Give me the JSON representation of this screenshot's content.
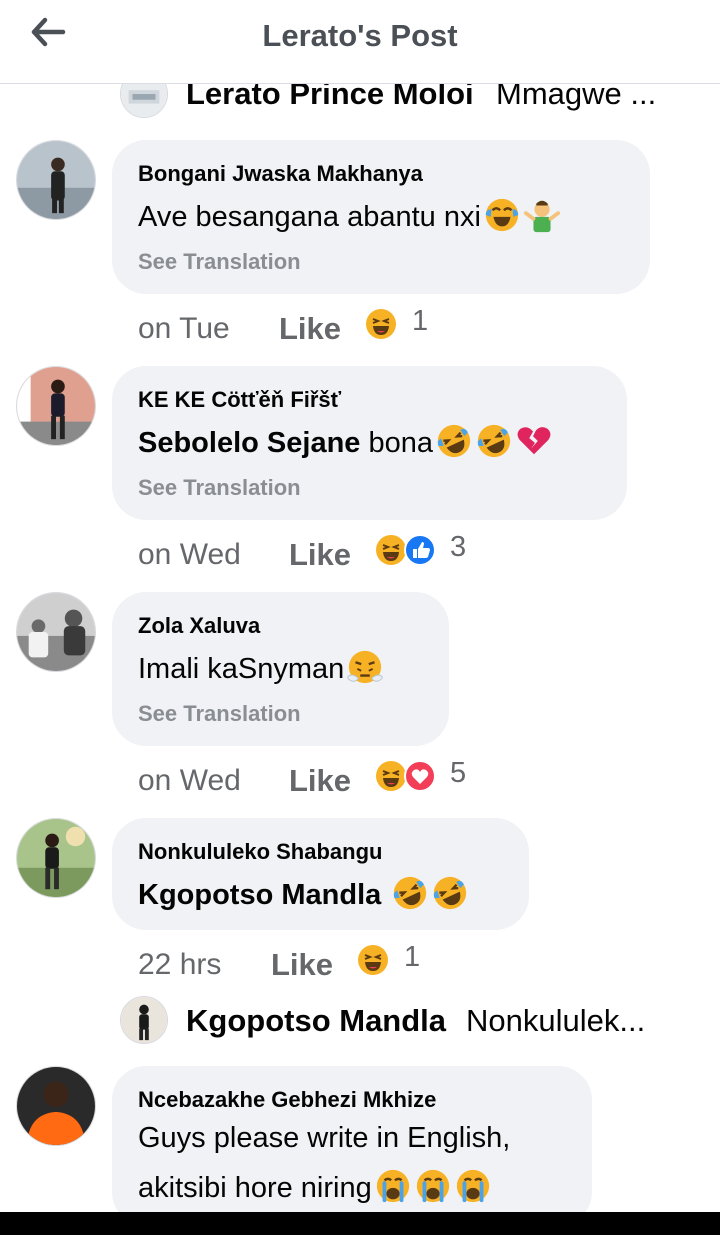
{
  "header": {
    "title": "Lerato's Post"
  },
  "reply_top": {
    "name": "Lerato Prince Moloi",
    "snippet": "Mmagwe ..."
  },
  "comments": [
    {
      "author": "Bongani Jwaska Makhanya",
      "text": "Ave besangana abantu nxi",
      "see_translation": "See Translation",
      "time": "on Tue",
      "like": "Like",
      "reaction_count": "1"
    },
    {
      "author": "KE KE Cötťěň Fiřšť",
      "mention": "Sebolelo Sejane",
      "text": "bona",
      "see_translation": "See Translation",
      "time": "on Wed",
      "like": "Like",
      "reaction_count": "3"
    },
    {
      "author": "Zola Xaluva",
      "text": "Imali kaSnyman",
      "see_translation": "See Translation",
      "time": "on Wed",
      "like": "Like",
      "reaction_count": "5"
    },
    {
      "author": "Nonkululeko Shabangu",
      "mention": "Kgopotso Mandla",
      "time": "22 hrs",
      "like": "Like",
      "reaction_count": "1"
    },
    {
      "author": "Ncebazakhe Gebhezi Mkhize",
      "line1": "Guys please write in English,",
      "line2": "akitsibi hore niring"
    }
  ],
  "reply_bottom": {
    "name": "Kgopotso Mandla",
    "snippet": "Nonkululek..."
  },
  "colors": {
    "bubble": "#f0f2f5",
    "meta_gray": "#65676b",
    "translate_gray": "#8a8d91",
    "like_blue": "#1877f2",
    "love_red": "#f33e58",
    "haha_yellow": "#f7b125"
  },
  "icons": [
    "back-arrow-icon",
    "haha-reaction-icon",
    "like-reaction-icon",
    "love-reaction-icon",
    "tears-of-joy-emoji",
    "shrug-emoji",
    "rolling-laughing-emoji",
    "broken-heart-emoji",
    "steam-nose-emoji",
    "crying-emoji"
  ]
}
